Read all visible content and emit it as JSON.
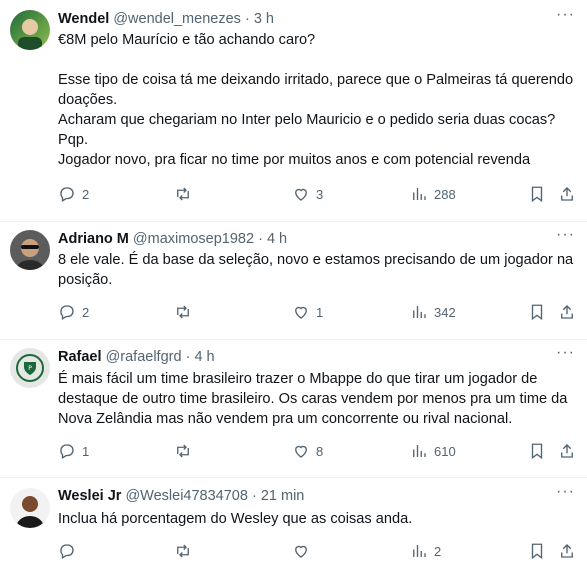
{
  "tweets": [
    {
      "name": "Wendel",
      "handle": "@wendel_menezes",
      "time": "3 h",
      "text": "€8M pelo Maurício e tão achando caro?\n\nEsse tipo de coisa tá me deixando irritado, parece que o Palmeiras tá querendo doações.\nAcharam que chegariam no Inter pelo Mauricio e o pedido seria duas cocas? Pqp.\nJogador novo, pra ficar no time por muitos anos e com potencial revenda",
      "replies": "2",
      "retweets": "",
      "likes": "3",
      "views": "288"
    },
    {
      "name": "Adriano M",
      "handle": "@maximosep1982",
      "time": "4 h",
      "text": "8 ele vale. É da base da seleção, novo e estamos precisando de um jogador na posição.",
      "replies": "2",
      "retweets": "",
      "likes": "1",
      "views": "342"
    },
    {
      "name": "Rafael",
      "handle": "@rafaelfgrd",
      "time": "4 h",
      "text": "É mais fácil um time brasileiro trazer o Mbappe do que tirar um jogador de destaque de outro time brasileiro. Os caras vendem por menos pra um time da Nova Zelândia mas não vendem pra um concorrente ou rival nacional.",
      "replies": "1",
      "retweets": "",
      "likes": "8",
      "views": "610"
    },
    {
      "name": "Weslei Jr",
      "handle": "@Weslei47834708",
      "time": "21 min",
      "text": "Inclua há porcentagem do Wesley que as coisas anda.",
      "replies": "",
      "retweets": "",
      "likes": "",
      "views": "2"
    }
  ],
  "separator": "·",
  "icons": {
    "reply": "reply-icon",
    "retweet": "retweet-icon",
    "like": "like-icon",
    "views": "views-icon",
    "bookmark": "bookmark-icon",
    "share": "share-icon",
    "more": "more-icon"
  },
  "colors": {
    "muted": "#536471",
    "text": "#0f1419",
    "divider": "#eff3f4"
  }
}
